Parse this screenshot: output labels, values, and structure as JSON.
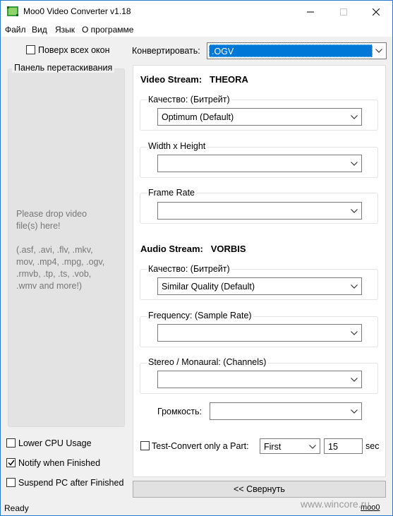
{
  "window": {
    "title": "Moo0 Video Converter v1.18",
    "minimize_icon": "minimize-icon",
    "maximize_icon": "maximize-icon",
    "close_icon": "close-icon"
  },
  "menu": [
    "Файл",
    "Вид",
    "Язык",
    "О программе"
  ],
  "left": {
    "always_on_top": {
      "label": "Поверх всех окон",
      "checked": false
    },
    "drop_panel_title": "Панель перетаскивания",
    "drop_text": [
      "Please drop video",
      "file(s) here!"
    ],
    "formats_text": [
      ".asf, .avi, .flv, .mkv,",
      "mov, .mp4, .mpg, .ogv,",
      ".rmvb, .tp, .ts, .vob,",
      ".wmv and more!)"
    ],
    "formats_prefix": "(",
    "lower_cpu": {
      "label": "Lower CPU Usage",
      "checked": false
    },
    "notify": {
      "label": "Notify when Finished",
      "checked": true
    },
    "suspend": {
      "label": "Suspend PC after Finished",
      "checked": false
    }
  },
  "convert": {
    "label": "Конвертировать:",
    "value": ".OGV"
  },
  "video": {
    "heading_label": "Video Stream:",
    "codec": "THEORA",
    "quality_label": "Качество:  (Битрейт)",
    "quality_value": "Optimum  (Default)",
    "size_label": "Width x Height",
    "size_value": "",
    "framerate_label": "Frame Rate",
    "framerate_value": ""
  },
  "audio": {
    "heading_label": "Audio Stream:",
    "codec": "VORBIS",
    "quality_label": "Качество:  (Битрейт)",
    "quality_value": "Similar Quality  (Default)",
    "frequency_label": "Frequency:  (Sample Rate)",
    "frequency_value": "",
    "channels_label": "Stereo / Monaural:  (Channels)",
    "channels_value": "",
    "volume_label": "Громкость:",
    "volume_value": ""
  },
  "test_convert": {
    "label": "Test-Convert only a Part:",
    "checked": false,
    "part_value": "First",
    "seconds_value": "15",
    "unit": "sec"
  },
  "collapse_button": "<< Свернуть",
  "status": {
    "text": "Ready",
    "brand": "moo0"
  },
  "watermark": "www.wincore.ru",
  "colors": {
    "selection": "#0078d7",
    "window_border": "#2b79c9"
  }
}
